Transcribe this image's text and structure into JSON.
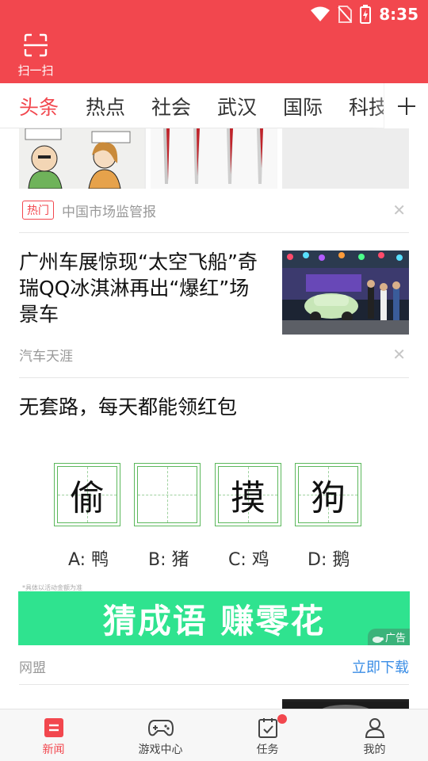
{
  "status_bar": {
    "time": "8:35"
  },
  "header": {
    "scan_label": "扫一扫"
  },
  "tabs": [
    {
      "label": "头条",
      "active": true
    },
    {
      "label": "热点"
    },
    {
      "label": "社会"
    },
    {
      "label": "武汉"
    },
    {
      "label": "国际"
    },
    {
      "label": "科技"
    }
  ],
  "feed": {
    "item1": {
      "badge": "热门",
      "source": "中国市场监管报"
    },
    "item2": {
      "title": "广州车展惊现“太空飞船”奇瑞QQ冰淇淋再出“爆红”场景车",
      "source": "汽车天涯"
    },
    "item3": {
      "title": "无套路，每天都能领红包",
      "idiom_chars": [
        "偷",
        "",
        "摸",
        "狗"
      ],
      "options": [
        "A: 鸭",
        "B: 猪",
        "C: 鸡",
        "D: 鹅"
      ],
      "ad_disclaimer": "*具体以活动金额为准",
      "ad_banner_text": "猜成语 赚零花",
      "ad_tag": "广告",
      "ad_source": "网盟",
      "cta": "立即下载"
    }
  },
  "bottom_nav": [
    {
      "label": "新闻",
      "icon": "news-icon",
      "active": true
    },
    {
      "label": "游戏中心",
      "icon": "gamepad-icon"
    },
    {
      "label": "任务",
      "icon": "task-icon",
      "badge_dot": true
    },
    {
      "label": "我的",
      "icon": "profile-icon"
    }
  ],
  "colors": {
    "brand": "#f2474e",
    "ad_green": "#2fe38f",
    "link_blue": "#3b8ee6"
  }
}
